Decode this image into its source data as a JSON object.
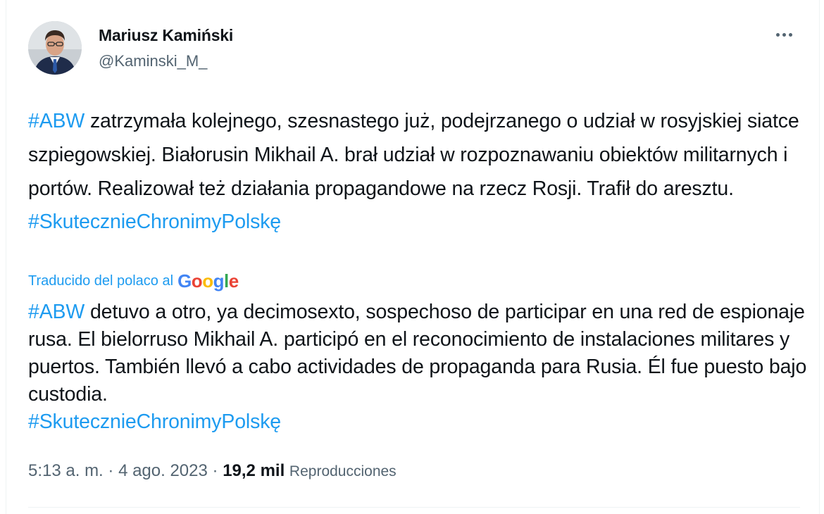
{
  "author": {
    "display_name": "Mariusz Kamiński",
    "handle": "@Kaminski_M_"
  },
  "tweet": {
    "hashtag_abw": "#ABW",
    "text_original": " zatrzymała kolejnego, szesnastego już, podejrzanego o udział w rosyjskiej siatce szpiegowskiej. Białorusin Mikhail A. brał udział w rozpoznawaniu obiektów militarnych i portów. Realizował też działania propagandowe na rzecz Rosji. Trafił do aresztu.",
    "hashtag_polska": "#SkutecznieChronimyPolskę",
    "translation_label": "Traducido del polaco al",
    "google_letters": [
      "G",
      "o",
      "o",
      "g",
      "l",
      "e"
    ],
    "google_colors": [
      "#4285f4",
      "#ea4335",
      "#fbbc05",
      "#4285f4",
      "#34a853",
      "#ea4335"
    ],
    "text_translated": " detuvo a otro, ya decimosexto, sospechoso de participar en una red de espionaje rusa. El bielorruso Mikhail A. participó en el reconocimiento de instalaciones militares y puertos. También llevó a cabo actividades de propaganda para Rusia. Él fue puesto bajo custodia."
  },
  "meta": {
    "time": "5:13 a. m.",
    "separator": " · ",
    "date": "4 ago. 2023",
    "views_count": "19,2 mil",
    "views_label": "Reproducciones"
  },
  "icons": {
    "more": "more-horizontal-icon"
  },
  "colors": {
    "link": "#1d9bf0",
    "text": "#0f1419",
    "secondary": "#536471"
  }
}
